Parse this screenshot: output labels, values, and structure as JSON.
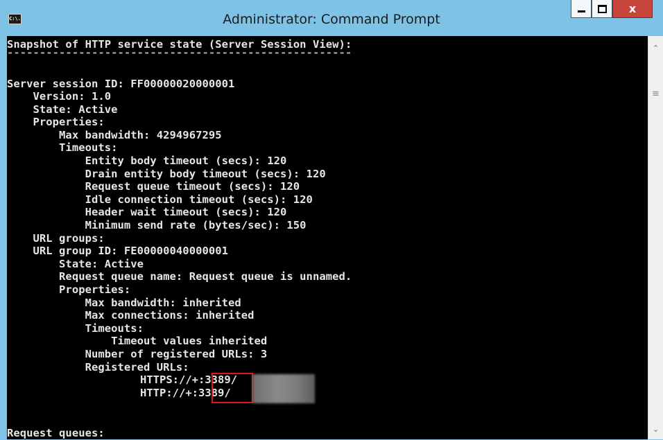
{
  "window": {
    "title": "Administrator: Command Prompt",
    "icon_label": "C:\\.",
    "buttons": {
      "minimize": "minimize-icon",
      "maximize": "maximize-icon",
      "close": "x"
    }
  },
  "console": {
    "lines": [
      "Snapshot of HTTP service state (Server Session View):",
      "-----------------------------------------------------",
      "",
      "Server session ID: FF00000020000001",
      "    Version: 1.0",
      "    State: Active",
      "    Properties:",
      "        Max bandwidth: 4294967295",
      "        Timeouts:",
      "            Entity body timeout (secs): 120",
      "            Drain entity body timeout (secs): 120",
      "            Request queue timeout (secs): 120",
      "            Idle connection timeout (secs): 120",
      "            Header wait timeout (secs): 120",
      "            Minimum send rate (bytes/sec): 150",
      "    URL groups:",
      "    URL group ID: FE00000040000001",
      "        State: Active",
      "        Request queue name: Request queue is unnamed.",
      "        Properties:",
      "            Max bandwidth: inherited",
      "            Max connections: inherited",
      "            Timeouts:",
      "                Timeout values inherited",
      "            Number of registered URLs: 3",
      "            Registered URLs:"
    ],
    "urls": [
      "HTTPS://+:3389/",
      "HTTP://+:3389/"
    ],
    "footer_line": "Request queues:"
  }
}
